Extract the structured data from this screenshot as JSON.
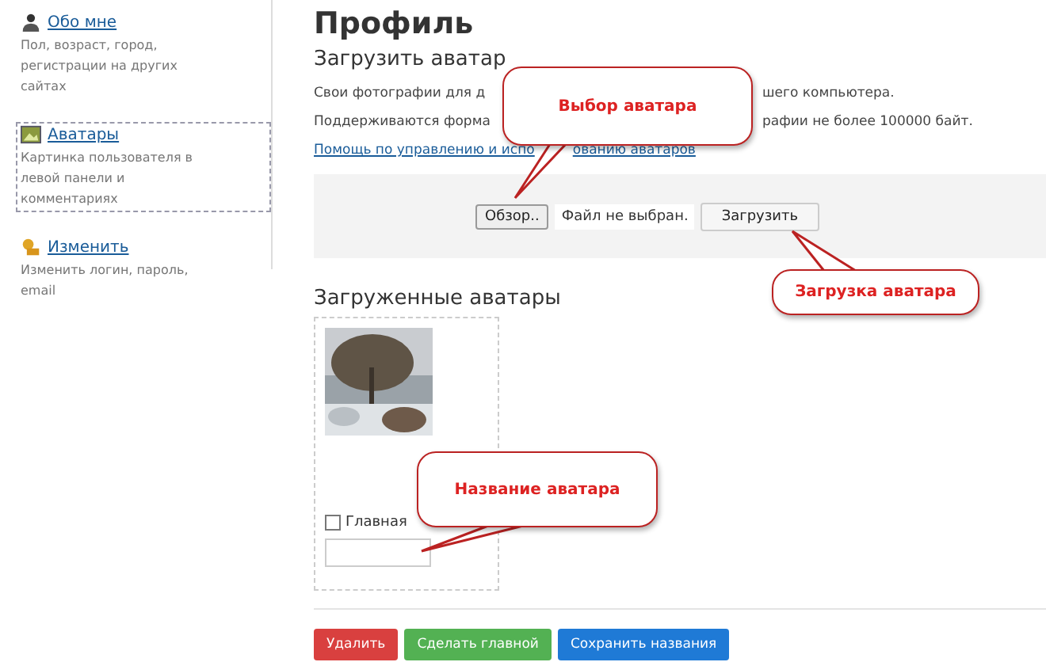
{
  "sidebar": {
    "items": [
      {
        "label": "Обо мне",
        "description": "Пол, возраст, город, регистрации на других сайтах",
        "selected": false
      },
      {
        "label": "Аватары",
        "description": "Картинка пользователя в левой панели и комментариях",
        "selected": true
      },
      {
        "label": "Изменить",
        "description": "Изменить логин, пароль, email",
        "selected": false
      }
    ]
  },
  "page_title": "Профиль",
  "upload": {
    "heading": "Загрузить аватар",
    "lines": [
      [
        "Свои фотографии для д",
        "шего компьютера."
      ],
      [
        "Поддерживаются форма",
        "рафии не более 100000 байт."
      ]
    ],
    "help_link": [
      "Помощь по управлению и испо",
      "ованию аватаров"
    ],
    "browse_button": "Обзор..",
    "file_status": "Файл не выбран.",
    "upload_button": "Загрузить"
  },
  "avatars": {
    "heading": "Загруженные аватары",
    "items": [
      {
        "kind": "picture",
        "main_label": "Главная",
        "main_checked": false
      }
    ]
  },
  "actions": [
    {
      "label": "Удалить",
      "color": "#d9403f"
    },
    {
      "label": "Сделать главной",
      "color": "#53b153"
    },
    {
      "label": "Сохранить названия",
      "color": "#1f7ad6"
    }
  ],
  "callouts": [
    {
      "text": "Выбор аватара"
    },
    {
      "text": "Загрузка аватара"
    },
    {
      "text": "Название аватара"
    }
  ]
}
